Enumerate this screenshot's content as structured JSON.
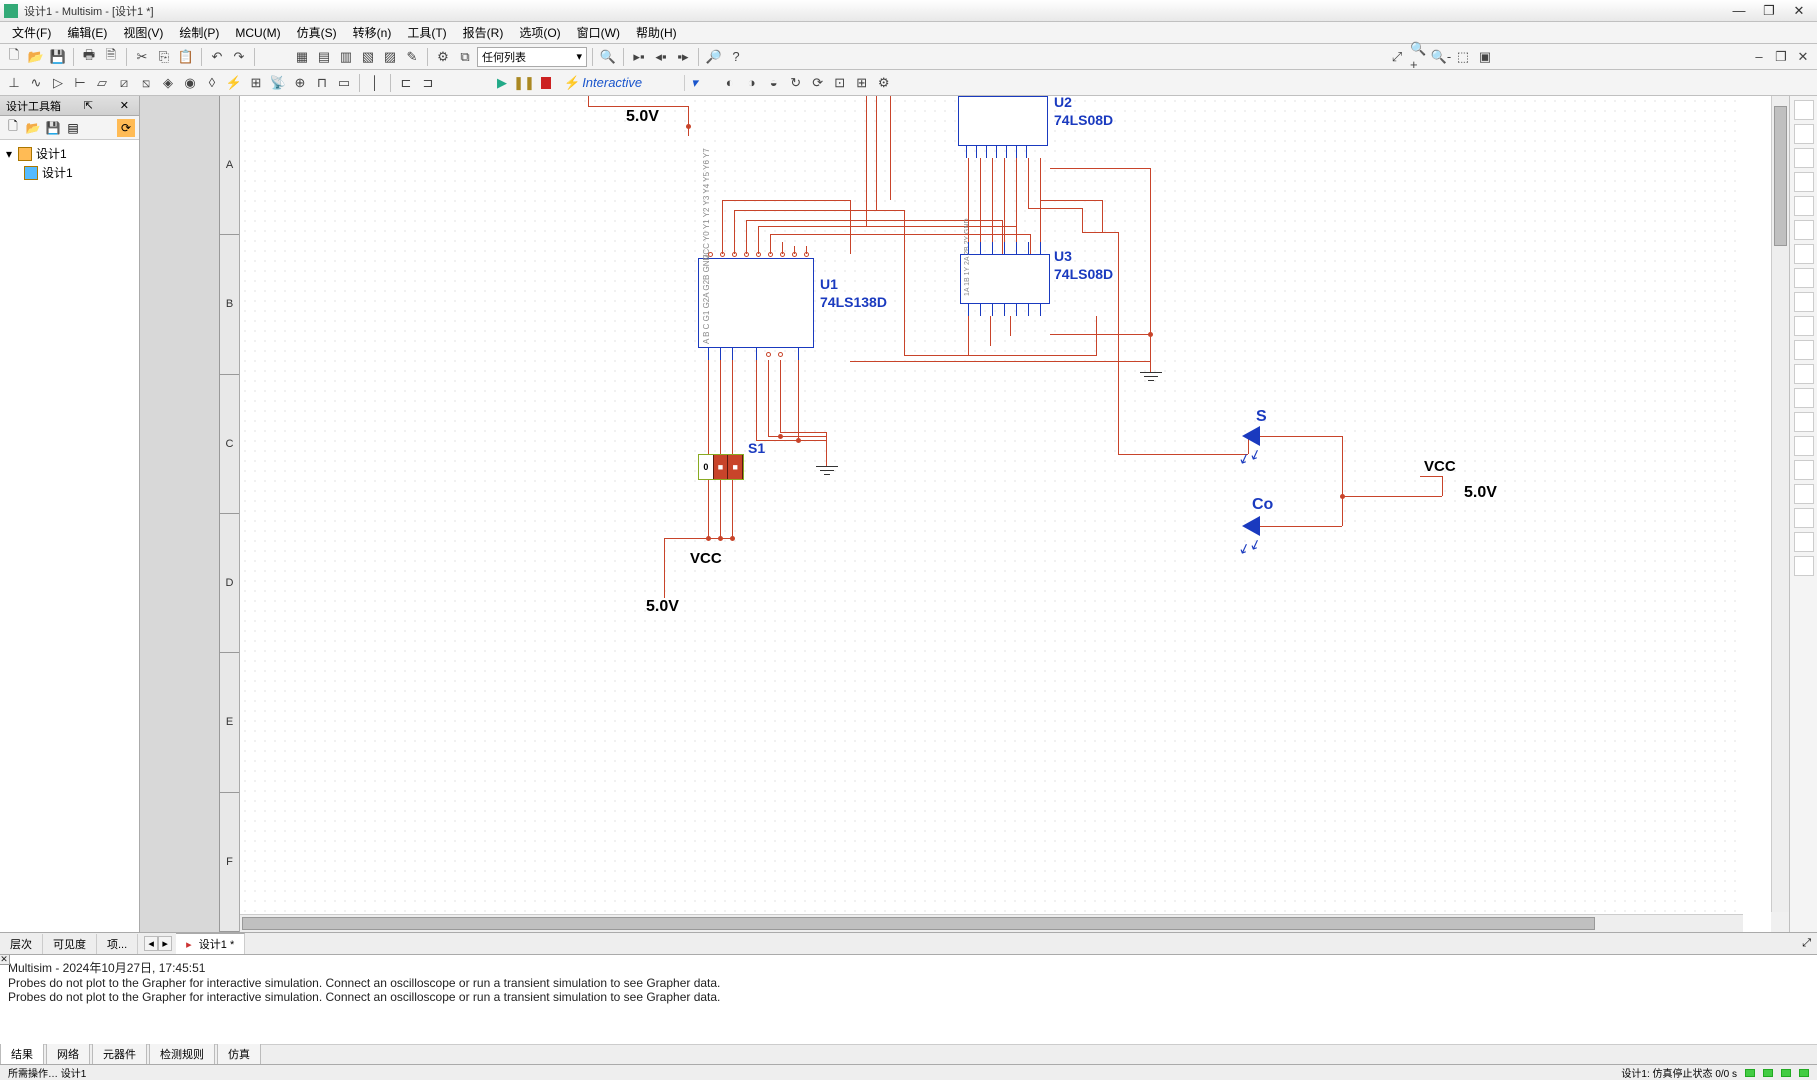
{
  "window": {
    "title": "设计1 - Multisim - [设计1 *]",
    "min": "—",
    "max": "❐",
    "close": "✕"
  },
  "menu": [
    "文件(F)",
    "编辑(E)",
    "视图(V)",
    "绘制(P)",
    "MCU(M)",
    "仿真(S)",
    "转移(n)",
    "工具(T)",
    "报告(R)",
    "选项(O)",
    "窗口(W)",
    "帮助(H)"
  ],
  "toolbar_combo": "任何列表",
  "sim": {
    "mode": "Interactive"
  },
  "side": {
    "title": "设计工具箱",
    "tree_root": "设计1",
    "tree_child": "设计1"
  },
  "ruler_rows": [
    "A",
    "B",
    "C",
    "D",
    "E",
    "F"
  ],
  "schematic": {
    "u1": {
      "ref": "U1",
      "part": "74LS138D"
    },
    "u2": {
      "ref": "U2",
      "part": "74LS08D"
    },
    "u3": {
      "ref": "U3",
      "part": "74LS08D"
    },
    "s1": "S1",
    "probe_s": "S",
    "probe_co": "Co",
    "vcc": "VCC",
    "v5": "5.0V"
  },
  "bottom_tabs": {
    "left": [
      "层次",
      "可见度",
      "项..."
    ],
    "sheet": "设计1 *"
  },
  "output": {
    "line1": "Multisim  -  2024年10月27日, 17:45:51",
    "line2": "Probes do not plot to the Grapher for interactive simulation. Connect an oscilloscope or run a transient simulation to see Grapher data.",
    "line3": "Probes do not plot to the Grapher for interactive simulation. Connect an oscilloscope or run a transient simulation to see Grapher data.",
    "tabs": [
      "结果",
      "网络",
      "元器件",
      "检测规则",
      "仿真"
    ]
  },
  "status": {
    "left": "所需操作… 设计1",
    "right": "设计1: 仿真停止状态 0/0 s"
  }
}
